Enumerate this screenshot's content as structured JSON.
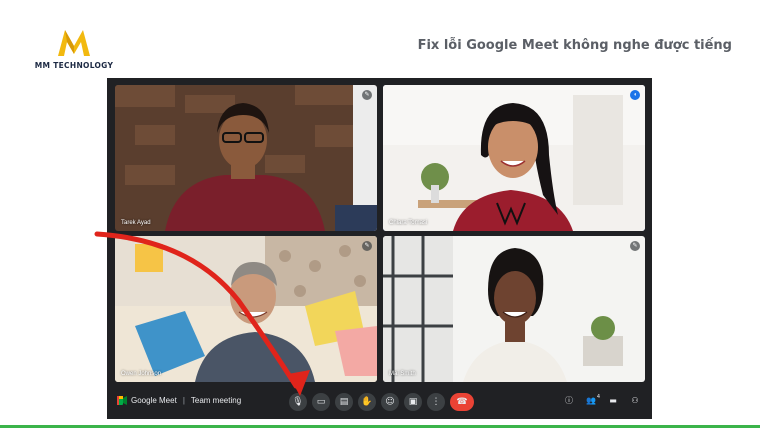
{
  "brand": {
    "logo_letter": "M",
    "name": "MM TECHNOLOGY",
    "colors": {
      "logo_gold": "#f2b90f",
      "logo_dark": "#1d2a44"
    }
  },
  "headline": "Fix lỗi Google Meet không nghe được tiếng",
  "meet": {
    "participants": [
      {
        "name": "Tarek Ayad",
        "indicator_icon": "more-options-icon",
        "speaking": false
      },
      {
        "name": "Chiara Tomasi",
        "indicator_icon": "speaking-audio-icon",
        "speaking": true
      },
      {
        "name": "Owen Johnson",
        "indicator_icon": "more-options-icon",
        "speaking": false
      },
      {
        "name": "Mai Smith",
        "indicator_icon": "more-options-icon",
        "speaking": false
      }
    ],
    "toolbar": {
      "app_name": "Google Meet",
      "separator": "|",
      "meeting_name": "Team meeting",
      "controls": [
        {
          "name": "mic-icon",
          "glyph": "🎙"
        },
        {
          "name": "camera-icon",
          "glyph": "▭"
        },
        {
          "name": "captions-icon",
          "glyph": "▤"
        },
        {
          "name": "raise-hand-icon",
          "glyph": "✋"
        },
        {
          "name": "emoji-icon",
          "glyph": "☺"
        },
        {
          "name": "present-icon",
          "glyph": "▣"
        },
        {
          "name": "more-icon",
          "glyph": "⋮"
        },
        {
          "name": "hangup-icon",
          "glyph": "☎"
        }
      ],
      "right_icons": [
        {
          "name": "info-icon",
          "glyph": "ⓘ"
        },
        {
          "name": "people-icon",
          "glyph": "👥",
          "badge": "4"
        },
        {
          "name": "chat-icon",
          "glyph": "▬"
        },
        {
          "name": "activities-icon",
          "glyph": "⚇"
        }
      ]
    },
    "colors": {
      "background": "#202124",
      "control_bg": "#3c4043",
      "hangup": "#ea4335",
      "speaking_border": "#8ab4f8",
      "annotation_arrow": "#e0241b"
    }
  },
  "footer_line_color": "#3bb44a"
}
